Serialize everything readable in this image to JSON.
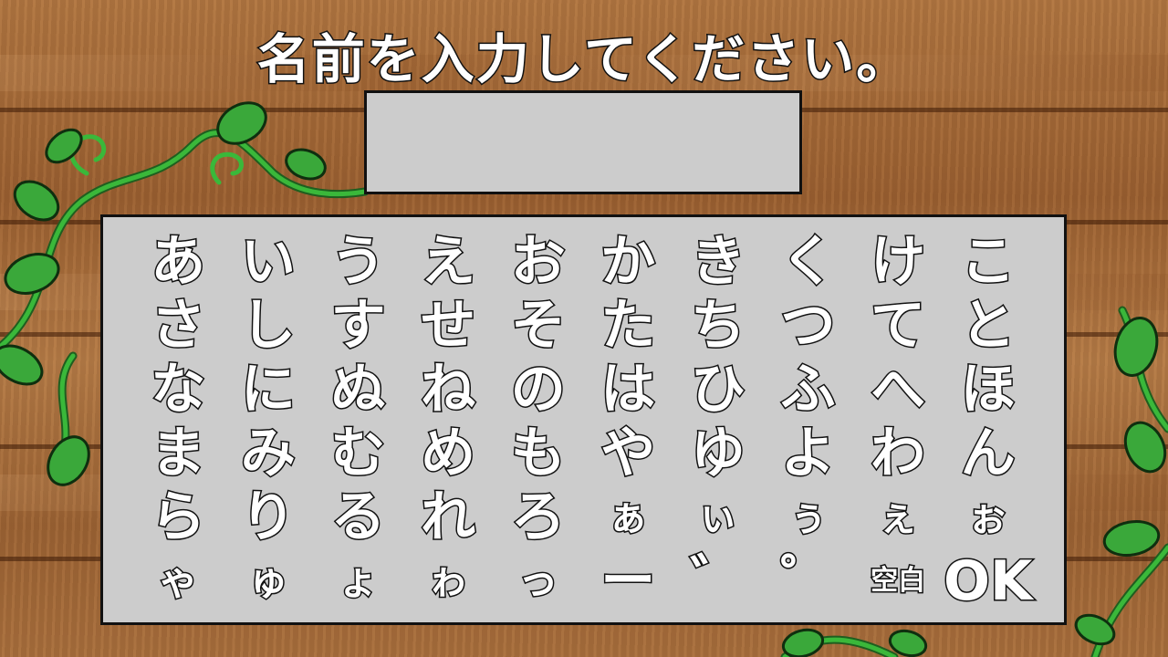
{
  "title": "名前を入力してください。",
  "name_value": "",
  "keyboard": {
    "rows": [
      [
        "あ",
        "い",
        "う",
        "え",
        "お",
        "か",
        "き",
        "く",
        "け",
        "こ"
      ],
      [
        "さ",
        "し",
        "す",
        "せ",
        "そ",
        "た",
        "ち",
        "つ",
        "て",
        "と"
      ],
      [
        "な",
        "に",
        "ぬ",
        "ね",
        "の",
        "は",
        "ひ",
        "ふ",
        "へ",
        "ほ"
      ],
      [
        "ま",
        "み",
        "む",
        "め",
        "も",
        "や",
        "ゆ",
        "よ",
        "わ",
        "ん"
      ],
      [
        "ら",
        "り",
        "る",
        "れ",
        "ろ",
        "ぁ",
        "ぃ",
        "ぅ",
        "ぇ",
        "ぉ"
      ],
      [
        "ゃ",
        "ゅ",
        "ょ",
        "ゎ",
        "っ",
        "ー",
        "゛",
        "゜",
        "空白",
        "OK"
      ]
    ]
  },
  "colors": {
    "panel": "#cccccc",
    "border": "#111111",
    "text": "#ffffff",
    "leaf": "#3aa83a",
    "vine": "#2e8b2e"
  },
  "icons": [
    "vine-decoration-icon"
  ]
}
